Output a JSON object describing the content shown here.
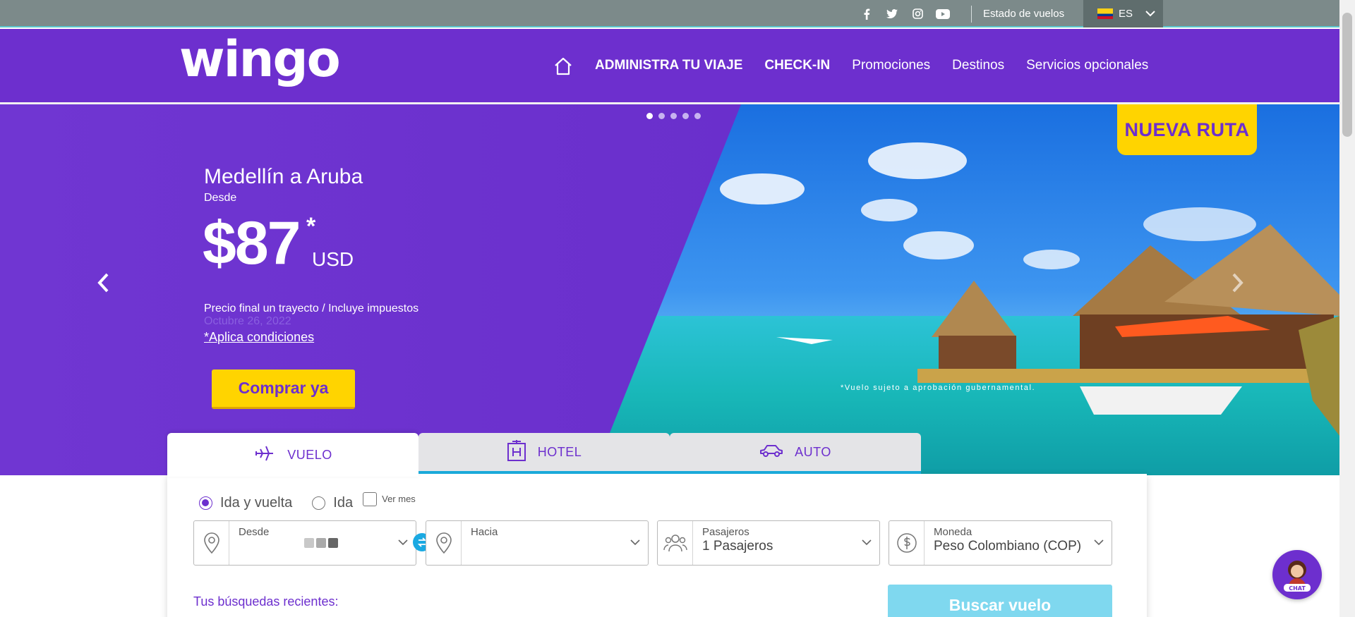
{
  "topbar": {
    "social_icons": [
      "facebook-icon",
      "twitter-icon",
      "instagram-icon",
      "youtube-icon"
    ],
    "flight_status": "Estado de vuelos",
    "language": "ES"
  },
  "nav": {
    "logo_text": "wingo",
    "items": [
      {
        "label": "ADMINISTRA TU VIAJE",
        "bold": true
      },
      {
        "label": "CHECK-IN",
        "bold": true
      },
      {
        "label": "Promociones",
        "bold": false
      },
      {
        "label": "Destinos",
        "bold": false
      },
      {
        "label": "Servicios opcionales",
        "bold": false
      }
    ]
  },
  "hero": {
    "badge": "NUEVA RUTA",
    "route": "Medellín a Aruba",
    "from_label": "Desde",
    "price": "$87",
    "price_mark": "*",
    "currency": "USD",
    "price_note": "Precio final un trayecto / Incluye impuestos",
    "date": "Octubre 26, 2022",
    "conditions": "*Aplica condiciones",
    "cta": "Comprar ya",
    "disclaimer": "*Vuelo sujeto a aprobación gubernamental.",
    "slides_total": 5,
    "active_slide": 1
  },
  "search": {
    "tabs": [
      {
        "label": "VUELO",
        "icon": "plane-icon",
        "active": true
      },
      {
        "label": "HOTEL",
        "icon": "hotel-icon",
        "active": false
      },
      {
        "label": "AUTO",
        "icon": "car-icon",
        "active": false
      }
    ],
    "trip_options": {
      "round_trip": "Ida y vuelta",
      "one_way": "Ida",
      "month": "Ver mes"
    },
    "fields": {
      "from_label": "Desde",
      "to_label": "Hacia",
      "passengers_label": "Pasajeros",
      "passengers_value": "1 Pasajeros",
      "currency_label": "Moneda",
      "currency_value": "Peso Colombiano (COP)"
    },
    "recent": "Tus búsquedas recientes:",
    "search_button": "Buscar vuelo"
  },
  "chat": {
    "label": "CHAT"
  },
  "colors": {
    "brand": "#6d2fce",
    "accent": "#ffd400",
    "topbar": "#7c8a8a",
    "cyan": "#1aa9d9"
  }
}
